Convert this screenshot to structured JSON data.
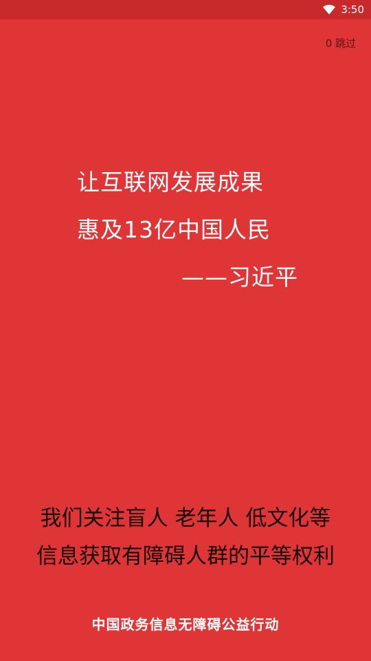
{
  "status_bar": {
    "time": "3:50",
    "wifi_icon": "wifi-icon"
  },
  "skip": {
    "label": "0 跳过"
  },
  "quote": {
    "line1": "让互联网发展成果",
    "line2": "惠及13亿中国人民",
    "author": "——习近平"
  },
  "focus": {
    "line1": "我们关注盲人  老年人  低文化等",
    "line2": "信息获取有障碍人群的平等权利"
  },
  "footer": {
    "text": "中国政务信息无障碍公益行动"
  },
  "colors": {
    "background": "#e03536",
    "status_bar": "#c82a2b",
    "text_light": "#ffffff",
    "text_dark": "#140404"
  }
}
